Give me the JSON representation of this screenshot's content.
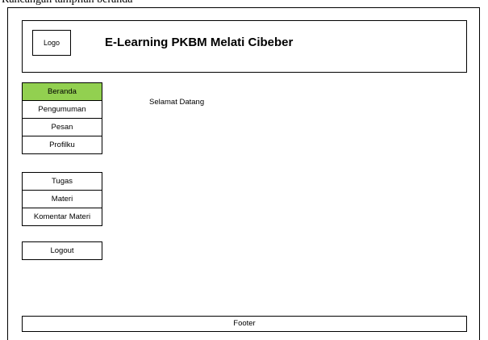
{
  "page": {
    "top_caption": "Rancangan tampilan beranda"
  },
  "header": {
    "logo_label": "Logo",
    "title": "E-Learning PKBM Melati Cibeber"
  },
  "sidebar": {
    "group1": [
      {
        "label": "Beranda",
        "active": true
      },
      {
        "label": "Pengumuman",
        "active": false
      },
      {
        "label": "Pesan",
        "active": false
      },
      {
        "label": "Profilku",
        "active": false
      }
    ],
    "group2": [
      {
        "label": "Tugas",
        "active": false
      },
      {
        "label": "Materi",
        "active": false
      },
      {
        "label": "Komentar Materi",
        "active": false
      }
    ],
    "group3": [
      {
        "label": "Logout",
        "active": false
      }
    ]
  },
  "main": {
    "welcome_text": "Selamat Datang"
  },
  "footer": {
    "label": "Footer"
  },
  "colors": {
    "active_nav": "#92d050",
    "border": "#000000",
    "background": "#ffffff"
  }
}
